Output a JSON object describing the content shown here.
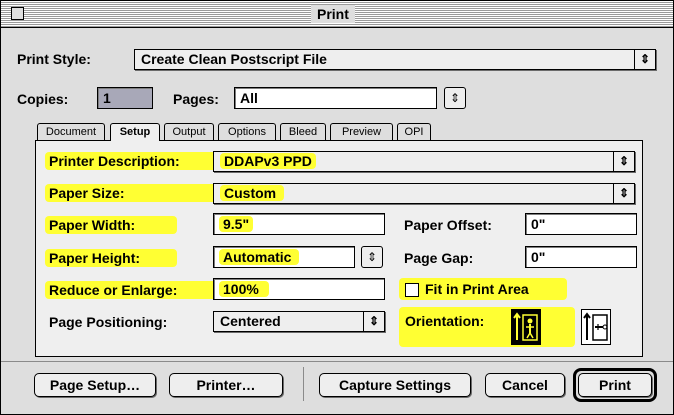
{
  "window": {
    "title": "Print"
  },
  "print_style": {
    "label": "Print Style:",
    "value": "Create Clean Postscript File"
  },
  "copies": {
    "label": "Copies:",
    "value": "1"
  },
  "pages": {
    "label": "Pages:",
    "value": "All"
  },
  "tabs": [
    {
      "label": "Document",
      "active": false
    },
    {
      "label": "Setup",
      "active": true
    },
    {
      "label": "Output",
      "active": false
    },
    {
      "label": "Options",
      "active": false
    },
    {
      "label": "Bleed",
      "active": false
    },
    {
      "label": "Preview",
      "active": false
    },
    {
      "label": "OPI",
      "active": false
    }
  ],
  "setup": {
    "printer_description": {
      "label": "Printer Description:",
      "value": "DDAPv3 PPD"
    },
    "paper_size": {
      "label": "Paper Size:",
      "value": "Custom"
    },
    "paper_width": {
      "label": "Paper Width:",
      "value": "9.5\""
    },
    "paper_offset": {
      "label": "Paper Offset:",
      "value": "0\""
    },
    "paper_height": {
      "label": "Paper Height:",
      "value": "Automatic"
    },
    "page_gap": {
      "label": "Page Gap:",
      "value": "0\""
    },
    "reduce_enlarge": {
      "label": "Reduce or Enlarge:",
      "value": "100%"
    },
    "fit_in_print_area": {
      "label": "Fit in Print Area",
      "checked": false
    },
    "page_positioning": {
      "label": "Page Positioning:",
      "value": "Centered"
    },
    "orientation": {
      "label": "Orientation:",
      "selected": "portrait"
    }
  },
  "buttons": {
    "page_setup": "Page Setup…",
    "printer": "Printer…",
    "capture_settings": "Capture Settings",
    "cancel": "Cancel",
    "print": "Print"
  },
  "icons": {
    "popup": "updown-arrows-icon",
    "stepper": "updown-arrows-icon"
  },
  "colors": {
    "highlight": "#ffff33",
    "window_bg": "#dedede",
    "panel_bg": "#efefef"
  }
}
